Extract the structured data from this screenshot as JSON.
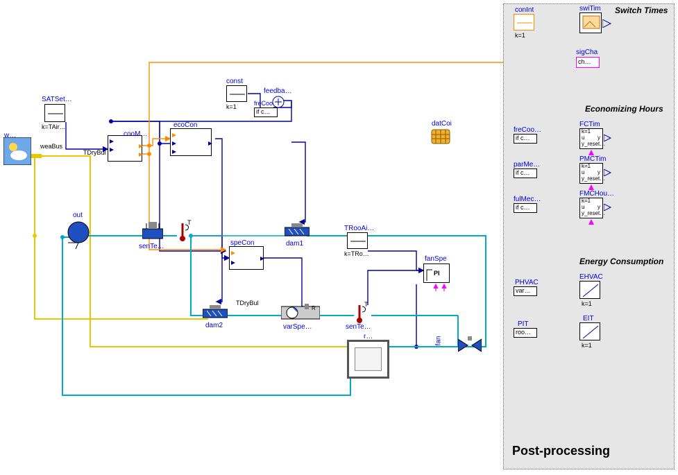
{
  "post_processing": {
    "panel_title": "Post-processing",
    "sections": {
      "switch_times": "Switch Times",
      "economizing_hours": "Economizing Hours",
      "energy_consumption": "Energy Consumption"
    },
    "blocks": {
      "conInt": {
        "label": "conInt",
        "param": "k=1"
      },
      "swiTim": {
        "label": "swiTim"
      },
      "sigCha": {
        "label": "sigCha",
        "inner": "ch…"
      },
      "freCoo2": {
        "label": "freCoo…",
        "inner": "if c…"
      },
      "FCTim": {
        "label": "FCTim",
        "l1": "k=1",
        "l2": "u",
        "l3": "y_reset…",
        "y": "y"
      },
      "parMe": {
        "label": "parMe…",
        "inner": "if c…"
      },
      "PMCTim": {
        "label": "PMCTim",
        "l1": "k=1",
        "l2": "u",
        "l3": "y_reset…",
        "y": "y"
      },
      "fulMec": {
        "label": "fulMec…",
        "inner": "if c…"
      },
      "FMCHou": {
        "label": "FMCHou…",
        "l1": "k=1",
        "l2": "u",
        "l3": "y_reset…",
        "y": "y"
      },
      "PHVAC": {
        "label": "PHVAC",
        "inner": "var…"
      },
      "EHVAC": {
        "label": "EHVAC",
        "param": "k=1"
      },
      "PIT": {
        "label": "PIT",
        "inner": "roo…"
      },
      "EIT": {
        "label": "EIT",
        "param": "k=1"
      }
    }
  },
  "main": {
    "weather": {
      "label": "w…",
      "bus": "weaBus"
    },
    "SATSet": {
      "label": "SATSet…",
      "param": "k=TAir…"
    },
    "TDryBul": "TDryBul",
    "TDryBul2": "TDryBul",
    "cooM": {
      "label": "cooM…"
    },
    "ecoCon": {
      "label": "ecoCon"
    },
    "const": {
      "label": "const",
      "param": "k=1"
    },
    "feedba": {
      "label": "feedba…"
    },
    "freCoo": {
      "label": "freCoo",
      "inner": "if c…"
    },
    "out": {
      "label": "out"
    },
    "senTe1": {
      "label": "senTe…"
    },
    "T1": {
      "label": "T"
    },
    "dam1": {
      "label": "dam1"
    },
    "dam2": {
      "label": "dam2"
    },
    "speCon": {
      "label": "speCon"
    },
    "TRooAi": {
      "label": "TRooAi…",
      "param": "k=TRo…"
    },
    "fanSpe": {
      "label": "fanSpe",
      "inner": "PI"
    },
    "varSpe": {
      "label": "varSpe…"
    },
    "senTe2": {
      "label": "senTe…"
    },
    "T2": {
      "label": "T"
    },
    "fan": {
      "label": "fan"
    },
    "datCoi": {
      "label": "datCoi"
    },
    "room": {
      "label": "r…"
    }
  }
}
